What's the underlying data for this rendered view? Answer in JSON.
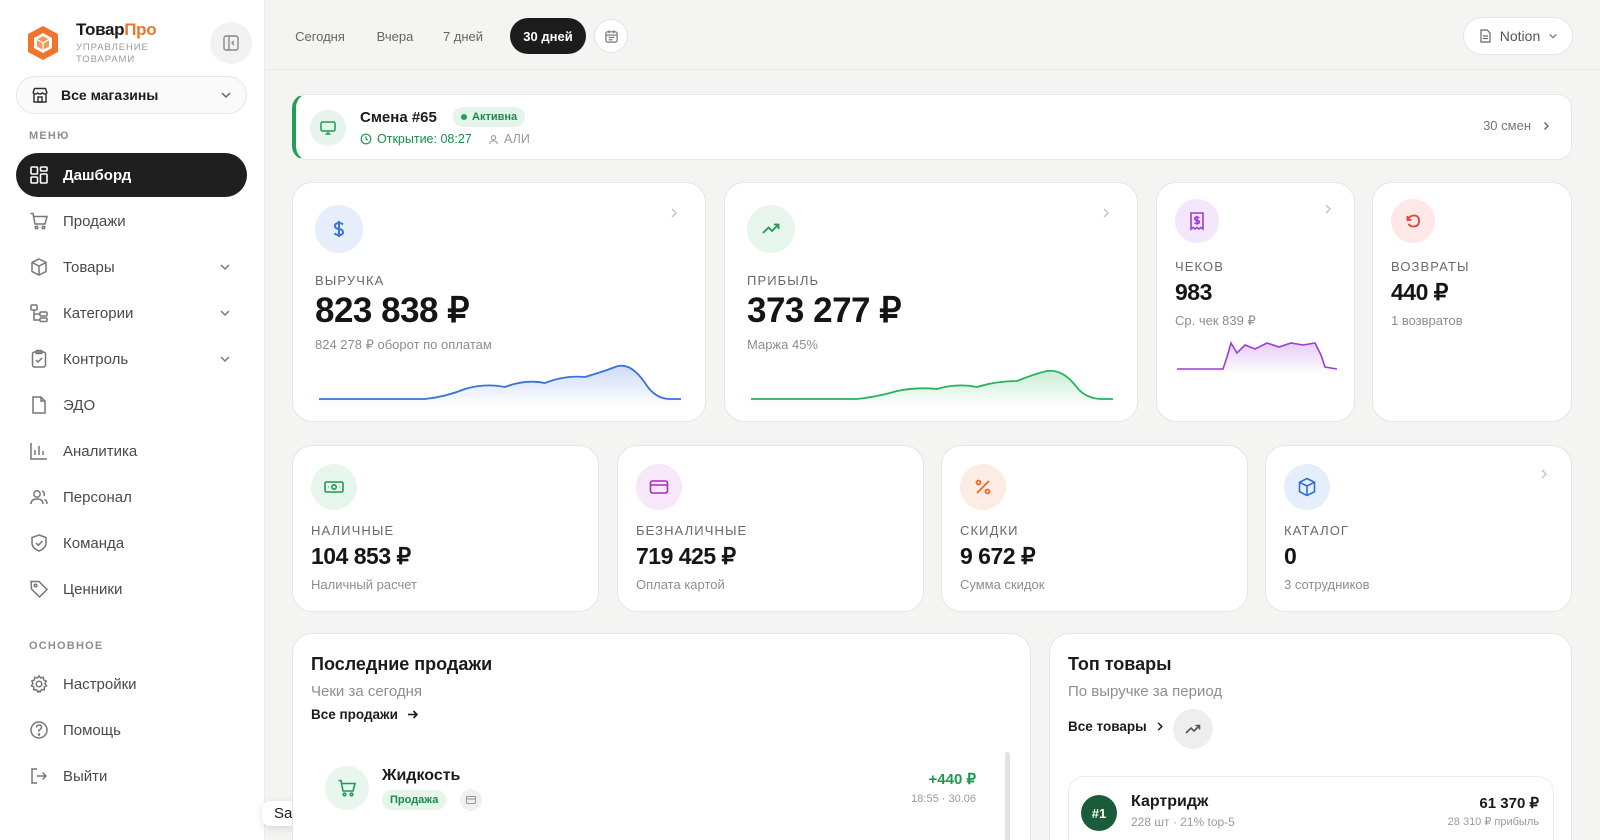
{
  "brand": {
    "name_main": "Товар",
    "name_accent": "Про",
    "subtitle": "УПРАВЛЕНИЕ ТОВАРАМИ"
  },
  "store_select": {
    "label": "Все магазины"
  },
  "sidebar": {
    "menu_label": "МЕНЮ",
    "items": [
      {
        "label": "Дашборд"
      },
      {
        "label": "Продажи"
      },
      {
        "label": "Товары"
      },
      {
        "label": "Категории"
      },
      {
        "label": "Контроль"
      },
      {
        "label": "ЭДО"
      },
      {
        "label": "Аналитика"
      },
      {
        "label": "Персонал"
      },
      {
        "label": "Команда"
      },
      {
        "label": "Ценники"
      }
    ],
    "main_label": "ОСНОВНОЕ",
    "bottom_items": [
      {
        "label": "Настройки"
      },
      {
        "label": "Помощь"
      },
      {
        "label": "Выйти"
      }
    ]
  },
  "tooltip": "Safari",
  "periods": [
    "Сегодня",
    "Вчера",
    "7 дней",
    "30 дней"
  ],
  "active_period": "30 дней",
  "notion_label": "Notion",
  "shift": {
    "title": "Смена #65",
    "status": "Активна",
    "opened": "Открытие: 08:27",
    "user": "АЛИ",
    "count": "30 смен"
  },
  "kpi": {
    "revenue": {
      "label": "ВЫРУЧКА",
      "value": "823 838 ₽",
      "sub": "824 278 ₽ оборот по оплатам",
      "icon": "dollar-icon",
      "color": "#3b73d8"
    },
    "profit": {
      "label": "ПРИБЫЛЬ",
      "value": "373 277 ₽",
      "sub": "Маржа 45%",
      "icon": "trending-up-icon",
      "color": "#27b45c"
    },
    "checks": {
      "label": "ЧЕКОВ",
      "value": "983",
      "sub": "Ср. чек 839 ₽",
      "icon": "receipt-icon",
      "color": "#9b3ed6"
    },
    "returns": {
      "label": "ВОЗВРАТЫ",
      "value": "440 ₽",
      "sub": "1 возвратов",
      "icon": "undo-icon",
      "color": "#e0413a"
    },
    "cash": {
      "label": "НАЛИЧНЫЕ",
      "value": "104 853 ₽",
      "sub": "Наличный расчет",
      "icon": "banknote-icon",
      "color": "#1f9a55"
    },
    "card": {
      "label": "БЕЗНАЛИЧНЫЕ",
      "value": "719 425 ₽",
      "sub": "Оплата картой",
      "icon": "credit-card-icon",
      "color": "#a42fb8"
    },
    "discounts": {
      "label": "СКИДКИ",
      "value": "9 672 ₽",
      "sub": "Сумма скидок",
      "icon": "percent-icon",
      "color": "#ef6a27"
    },
    "catalog": {
      "label": "КАТАЛОГ",
      "value": "0",
      "sub": "3 сотрудников",
      "icon": "box-icon",
      "color": "#2d6fd6"
    }
  },
  "recent_sales": {
    "title": "Последние продажи",
    "subtitle": "Чеки за сегодня",
    "link": "Все продажи",
    "items": [
      {
        "name": "Жидкость",
        "badge": "Продажа",
        "amount": "+440 ₽",
        "time": "18:55 · 30.06"
      }
    ]
  },
  "top_products": {
    "title": "Топ товары",
    "subtitle": "По выручке за период",
    "link": "Все товары",
    "items": [
      {
        "rank": "#1",
        "name": "Картридж",
        "meta": "228 шт · 21% top-5",
        "amount": "61 370 ₽",
        "profit": "28 310 ₽ прибыль"
      }
    ]
  }
}
